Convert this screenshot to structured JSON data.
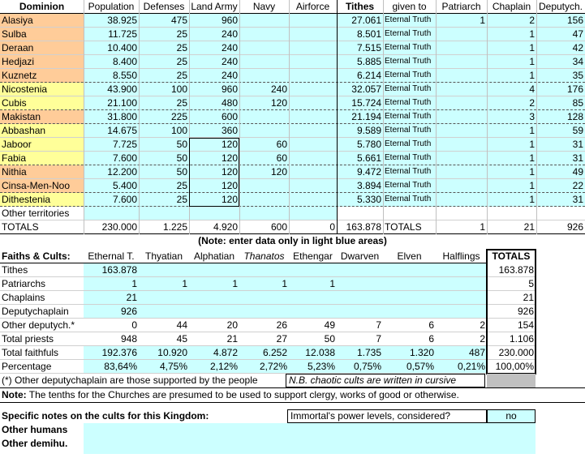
{
  "colors": {
    "blue": "#ccffff",
    "orange": "#ffcc99",
    "yellow": "#ffff99",
    "gray": "#c0c0c0"
  },
  "top": {
    "headers": [
      "Dominion",
      "Population",
      "Defenses",
      "Land Army",
      "Navy",
      "Airforce",
      "Tithes",
      "given to",
      "Patriarch",
      "Chaplain",
      "Deputych."
    ],
    "rows": [
      {
        "name": "Alasiya",
        "color": "orange",
        "pop": "38.925",
        "def": "475",
        "army": "960",
        "navy": "",
        "air": "",
        "tithes": "27.061",
        "given": "Eternal Truth",
        "pat": "1",
        "chap": "2",
        "dep": "156"
      },
      {
        "name": "Sulba",
        "color": "orange",
        "pop": "11.725",
        "def": "25",
        "army": "240",
        "navy": "",
        "air": "",
        "tithes": "8.501",
        "given": "Eternal Truth",
        "pat": "",
        "chap": "1",
        "dep": "47"
      },
      {
        "name": "Deraan",
        "color": "orange",
        "pop": "10.400",
        "def": "25",
        "army": "240",
        "navy": "",
        "air": "",
        "tithes": "7.515",
        "given": "Eternal Truth",
        "pat": "",
        "chap": "1",
        "dep": "42"
      },
      {
        "name": "Hedjazi",
        "color": "orange",
        "pop": "8.400",
        "def": "25",
        "army": "240",
        "navy": "",
        "air": "",
        "tithes": "5.885",
        "given": "Eternal Truth",
        "pat": "",
        "chap": "1",
        "dep": "34"
      },
      {
        "name": "Kuznetz",
        "color": "orange",
        "pop": "8.550",
        "def": "25",
        "army": "240",
        "navy": "",
        "air": "",
        "tithes": "6.214",
        "given": "Eternal Truth",
        "pat": "",
        "chap": "1",
        "dep": "35"
      },
      {
        "name": "Nicostenia",
        "color": "yellow",
        "pop": "43.900",
        "def": "100",
        "army": "960",
        "navy": "240",
        "air": "",
        "tithes": "32.057",
        "given": "Eternal Truth",
        "pat": "",
        "chap": "4",
        "dep": "176"
      },
      {
        "name": "Cubis",
        "color": "yellow",
        "pop": "21.100",
        "def": "25",
        "army": "480",
        "navy": "120",
        "air": "",
        "tithes": "15.724",
        "given": "Eternal Truth",
        "pat": "",
        "chap": "2",
        "dep": "85"
      },
      {
        "name": "Makistan",
        "color": "orange",
        "pop": "31.800",
        "def": "225",
        "army": "600",
        "navy": "",
        "air": "",
        "tithes": "21.194",
        "given": "Eternal Truth",
        "pat": "",
        "chap": "3",
        "dep": "128"
      },
      {
        "name": "Abbashan",
        "color": "yellow",
        "pop": "14.675",
        "def": "100",
        "army": "360",
        "navy": "",
        "air": "",
        "tithes": "9.589",
        "given": "Eternal Truth",
        "pat": "",
        "chap": "1",
        "dep": "59"
      },
      {
        "name": "Jaboor",
        "color": "yellow",
        "pop": "7.725",
        "def": "50",
        "army": "120",
        "navy": "60",
        "air": "",
        "tithes": "5.780",
        "given": "Eternal Truth",
        "pat": "",
        "chap": "1",
        "dep": "31"
      },
      {
        "name": "Fabia",
        "color": "yellow",
        "pop": "7.600",
        "def": "50",
        "army": "120",
        "navy": "60",
        "air": "",
        "tithes": "5.661",
        "given": "Eternal Truth",
        "pat": "",
        "chap": "1",
        "dep": "31"
      },
      {
        "name": "Nithia",
        "color": "orange",
        "pop": "12.200",
        "def": "50",
        "army": "120",
        "navy": "120",
        "air": "",
        "tithes": "9.472",
        "given": "Eternal Truth",
        "pat": "",
        "chap": "1",
        "dep": "49"
      },
      {
        "name": "Cinsa-Men-Noo",
        "color": "orange",
        "pop": "5.400",
        "def": "25",
        "army": "120",
        "navy": "",
        "air": "",
        "tithes": "3.894",
        "given": "Eternal Truth",
        "pat": "",
        "chap": "1",
        "dep": "22"
      },
      {
        "name": "Dithestenia",
        "color": "yellow",
        "pop": "7.600",
        "def": "25",
        "army": "120",
        "navy": "",
        "air": "",
        "tithes": "5.330",
        "given": "Eternal Truth",
        "pat": "",
        "chap": "1",
        "dep": "31"
      },
      {
        "name": "Other territories",
        "color": "none",
        "pop": "",
        "def": "",
        "army": "",
        "navy": "",
        "air": "",
        "tithes": "",
        "given": "",
        "pat": "",
        "chap": "",
        "dep": ""
      }
    ],
    "totals": {
      "label": "TOTALS",
      "pop": "230.000",
      "def": "1.225",
      "army": "4.920",
      "navy": "600",
      "air": "0",
      "tithes": "163.878",
      "label2": "TOTALS",
      "pat": "1",
      "chap": "21",
      "dep": "926"
    }
  },
  "note": "(Note: enter data only in light blue areas)",
  "faiths": {
    "title": "Faiths & Cults:",
    "cults": [
      {
        "name": "Ethernal T.",
        "italic": false
      },
      {
        "name": "Thyatian",
        "italic": false
      },
      {
        "name": "Alphatian",
        "italic": false
      },
      {
        "name": "Thanatos",
        "italic": true
      },
      {
        "name": "Ethengar",
        "italic": false
      },
      {
        "name": "Dwarven",
        "italic": false
      },
      {
        "name": "Elven",
        "italic": false
      },
      {
        "name": "Halflings",
        "italic": false
      }
    ],
    "totals_header": "TOTALS",
    "rows": [
      {
        "label": "Tithes",
        "values": [
          "163.878",
          "",
          "",
          "",
          "",
          "",
          "",
          ""
        ],
        "total": "163.878"
      },
      {
        "label": "Patriarchs",
        "values": [
          "1",
          "1",
          "1",
          "1",
          "1",
          "",
          "",
          ""
        ],
        "total": "5"
      },
      {
        "label": "Chaplains",
        "values": [
          "21",
          "",
          "",
          "",
          "",
          "",
          "",
          ""
        ],
        "total": "21"
      },
      {
        "label": "Deputychaplain",
        "values": [
          "926",
          "",
          "",
          "",
          "",
          "",
          "",
          ""
        ],
        "total": "926"
      },
      {
        "label": "Other deputych.*",
        "values": [
          "0",
          "44",
          "20",
          "26",
          "49",
          "7",
          "6",
          "2"
        ],
        "total": "154"
      },
      {
        "label": "Total priests",
        "values": [
          "948",
          "45",
          "21",
          "27",
          "50",
          "7",
          "6",
          "2"
        ],
        "total": "1.106"
      },
      {
        "label": "Total faithfuls",
        "values": [
          "192.376",
          "10.920",
          "4.872",
          "6.252",
          "12.038",
          "1.735",
          "1.320",
          "487"
        ],
        "total": "230.000"
      },
      {
        "label": "Percentage",
        "values": [
          "83,64%",
          "4,75%",
          "2,12%",
          "2,72%",
          "5,23%",
          "0,75%",
          "0,57%",
          "0,21%"
        ],
        "total": "100,00%"
      }
    ],
    "footnote": "(*) Other deputychaplain are those supported by the people",
    "cursive_note": "N.B. chaotic cults are written in cursive"
  },
  "note2_bold": "Note:",
  "note2_text": " The tenths for the Churches are presumed to be used to support clergy, works of good or otherwise.",
  "specific_label": "Specific notes on the cults for this Kingdom:",
  "immortal_label": "Immortal's power levels, considered?",
  "immortal_value": "no",
  "other_humans": "Other humans",
  "other_demihu": "Other demihu."
}
